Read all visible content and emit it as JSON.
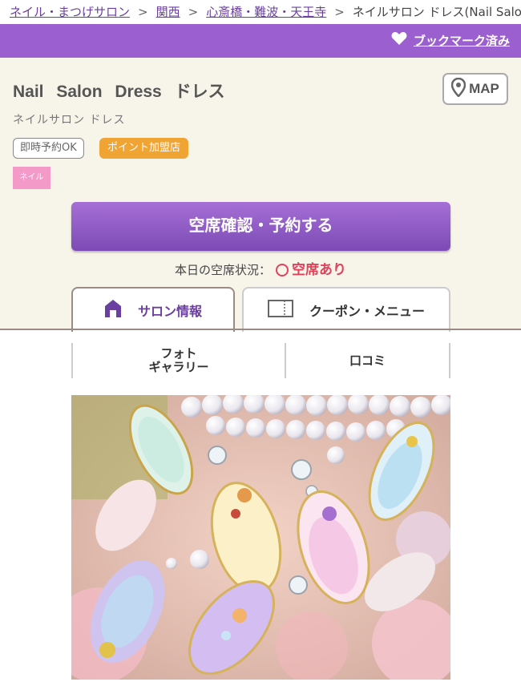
{
  "breadcrumb": {
    "items": [
      "ネイル・まつげサロン",
      "関西",
      "心斎橋・難波・天王寺"
    ],
    "current": "ネイルサロン ドレス(Nail Salon Dress)",
    "separator": ">"
  },
  "bookmark": {
    "label": "ブックマーク済み",
    "icon": "heart-icon"
  },
  "salon": {
    "name": "Nail Salon Dress ドレス",
    "kana": "ネイルサロン ドレス",
    "map_label": "MAP",
    "map_icon": "map-pin-icon",
    "tags": [
      "即時予約OK",
      "ポイント加盟店"
    ],
    "category": "ネイル"
  },
  "reserve": {
    "label": "空席確認・予約する"
  },
  "availability": {
    "label": "本日の空席状況：",
    "value": "空席あり"
  },
  "tabs": [
    {
      "label": "サロン情報",
      "icon": "house-icon",
      "active": true
    },
    {
      "label": "クーポン・メニュー",
      "icon": "ticket-icon",
      "active": false
    }
  ],
  "subnav": {
    "photo_line1": "フォト",
    "photo_line2": "ギャラリー",
    "reviews": "口コミ"
  },
  "colors": {
    "brand": "#9b5fcf",
    "accent": "#f0a434",
    "available": "#e0425b",
    "category": "#f39ac9"
  }
}
